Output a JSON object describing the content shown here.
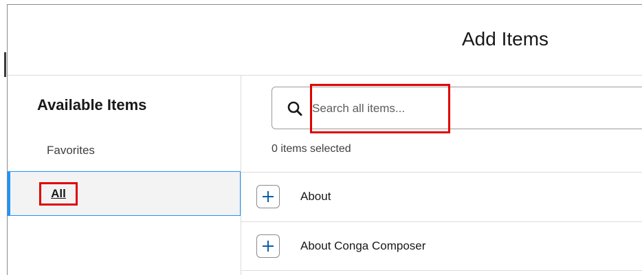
{
  "modal": {
    "title": "Add Items"
  },
  "sidebar": {
    "heading": "Available Items",
    "items": [
      {
        "label": "Favorites",
        "selected": false
      },
      {
        "label": "All",
        "selected": true
      }
    ]
  },
  "search": {
    "placeholder": "Search all items...",
    "value": ""
  },
  "selection": {
    "count_text": "0 items selected"
  },
  "items": [
    {
      "label": "About"
    },
    {
      "label": "About Conga Composer"
    }
  ],
  "colors": {
    "accent": "#1b96ff",
    "highlight": "#e00000",
    "selected_bg": "#f3f3f3",
    "border": "#dddbda"
  },
  "icons": {
    "search": "search-icon",
    "add": "plus-icon"
  }
}
